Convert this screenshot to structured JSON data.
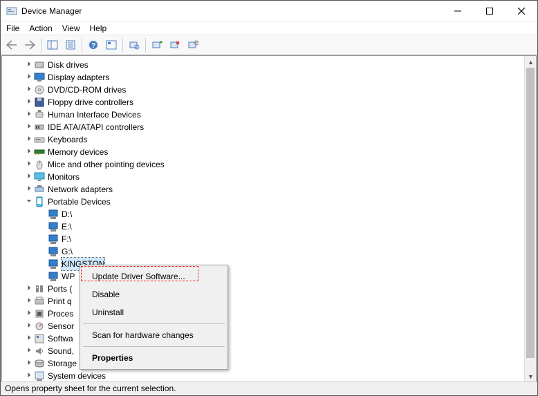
{
  "window": {
    "title": "Device Manager"
  },
  "menus": {
    "file": "File",
    "action": "Action",
    "view": "View",
    "help": "Help"
  },
  "tree": {
    "items": [
      {
        "label": "Disk drives",
        "expanded": false,
        "icon": "disk"
      },
      {
        "label": "Display adapters",
        "expanded": false,
        "icon": "display"
      },
      {
        "label": "DVD/CD-ROM drives",
        "expanded": false,
        "icon": "dvd"
      },
      {
        "label": "Floppy drive controllers",
        "expanded": false,
        "icon": "floppy"
      },
      {
        "label": "Human Interface Devices",
        "expanded": false,
        "icon": "hid"
      },
      {
        "label": "IDE ATA/ATAPI controllers",
        "expanded": false,
        "icon": "ide"
      },
      {
        "label": "Keyboards",
        "expanded": false,
        "icon": "keyboard"
      },
      {
        "label": "Memory devices",
        "expanded": false,
        "icon": "memory"
      },
      {
        "label": "Mice and other pointing devices",
        "expanded": false,
        "icon": "mouse"
      },
      {
        "label": "Monitors",
        "expanded": false,
        "icon": "monitor"
      },
      {
        "label": "Network adapters",
        "expanded": false,
        "icon": "network"
      },
      {
        "label": "Portable Devices",
        "expanded": true,
        "icon": "portable",
        "children": [
          {
            "label": "D:\\",
            "icon": "drive"
          },
          {
            "label": "E:\\",
            "icon": "drive"
          },
          {
            "label": "F:\\",
            "icon": "drive"
          },
          {
            "label": "G:\\",
            "icon": "drive"
          },
          {
            "label": "KINGSTON",
            "icon": "drive",
            "selected": true
          },
          {
            "label": "WP",
            "icon": "drive",
            "truncated": true
          }
        ]
      },
      {
        "label": "Ports (",
        "expanded": false,
        "icon": "ports",
        "truncated": true
      },
      {
        "label": "Print q",
        "expanded": false,
        "icon": "printer",
        "truncated": true
      },
      {
        "label": "Proces",
        "expanded": false,
        "icon": "cpu",
        "truncated": true
      },
      {
        "label": "Sensor",
        "expanded": false,
        "icon": "sensor",
        "truncated": true
      },
      {
        "label": "Softwa",
        "expanded": false,
        "icon": "software",
        "truncated": true
      },
      {
        "label": "Sound,",
        "expanded": false,
        "icon": "sound",
        "truncated": true
      },
      {
        "label": "Storage controllers",
        "expanded": false,
        "icon": "storage"
      },
      {
        "label": "System devices",
        "expanded": false,
        "icon": "system"
      }
    ]
  },
  "context_menu": {
    "items": [
      {
        "label": "Update Driver Software...",
        "highlight": true
      },
      {
        "label": "Disable"
      },
      {
        "label": "Uninstall"
      },
      {
        "sep": true
      },
      {
        "label": "Scan for hardware changes"
      },
      {
        "sep": true
      },
      {
        "label": "Properties",
        "bold": true
      }
    ]
  },
  "statusbar": {
    "text": "Opens property sheet for the current selection."
  }
}
